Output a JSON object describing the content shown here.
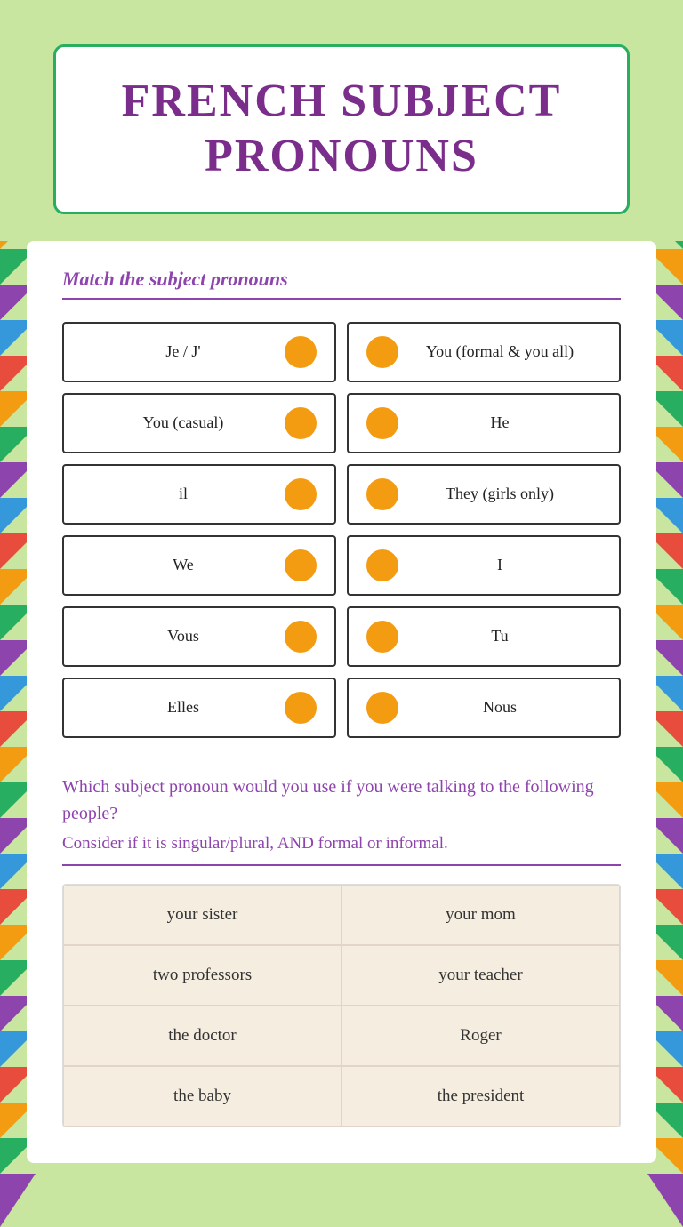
{
  "title": "FRENCH SUBJECT PRONOUNS",
  "match_section": {
    "heading": "Match the subject pronouns"
  },
  "left_items": [
    {
      "label": "Je / J'"
    },
    {
      "label": "You (casual)"
    },
    {
      "label": "il"
    },
    {
      "label": "We"
    },
    {
      "label": "Vous"
    },
    {
      "label": "Elles"
    }
  ],
  "right_items": [
    {
      "label": "You (formal & you all)"
    },
    {
      "label": "He"
    },
    {
      "label": "They (girls only)"
    },
    {
      "label": "I"
    },
    {
      "label": "Tu"
    },
    {
      "label": "Nous"
    }
  ],
  "question_section": {
    "question": "Which subject pronoun would you use if you were talking to the following people?",
    "subtext": "Consider if it is singular/plural, AND formal or informal."
  },
  "people": [
    {
      "col1": "your sister",
      "col2": "your mom"
    },
    {
      "col1": "two professors",
      "col2": "your teacher"
    },
    {
      "col1": "the doctor",
      "col2": "Roger"
    },
    {
      "col1": "the baby",
      "col2": "the president"
    }
  ]
}
